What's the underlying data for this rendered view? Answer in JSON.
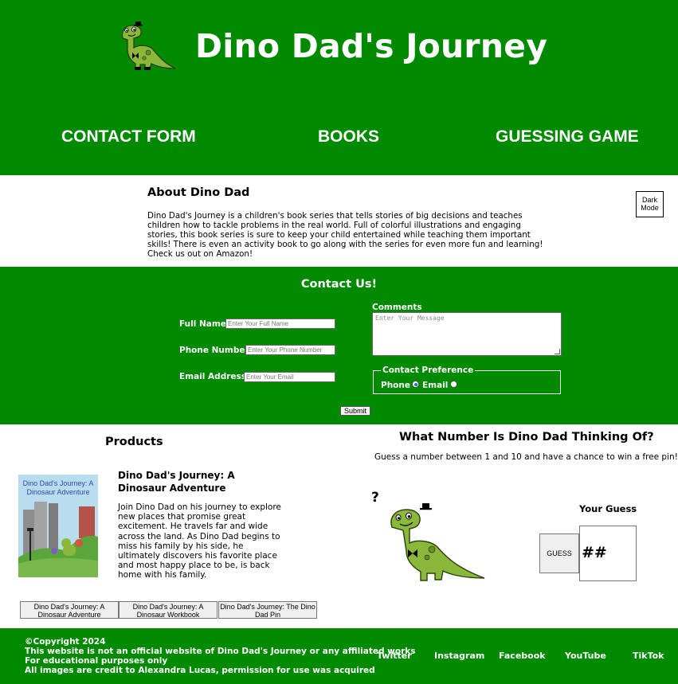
{
  "header": {
    "title": "Dino Dad's Journey",
    "nav": [
      "CONTACT FORM",
      "BOOKS",
      "GUESSING GAME"
    ]
  },
  "about": {
    "title": "About Dino Dad",
    "text": "Dino Dad's Journey is a children's book series that tells stories of big decisions and teaches children how to tackle problems in the real world. Full of colorful illustrations and engaging stories, this book series is sure to keep your child entertained while teaching them important skills! There is even an activity book to go along with the series for even more fun and learning! Check us out on Amazon!",
    "dark_mode_label": "Dark Mode"
  },
  "contact": {
    "title": "Contact Us!",
    "full_name_label": "Full Name:",
    "full_name_placeholder": "Enter Your Full Name",
    "phone_label": "Phone Number:",
    "phone_placeholder": "Enter Your Phone Number",
    "email_label": "Email Address:",
    "email_placeholder": "Enter Your Email",
    "comments_label": "Comments",
    "comments_placeholder": "Enter Your Message",
    "preference_legend": "Contact Preference",
    "option_phone": "Phone",
    "option_email": "Email",
    "selected_preference": "Phone",
    "submit_label": "Submit"
  },
  "products": {
    "title": "Products",
    "book": {
      "title": "Dino Dad's Journey: A Dinosaur Adventure",
      "cover_title": "Dino Dad's Journey: A Dinosaur Adventure",
      "description": "Join Dino Dad on his journey to explore new places that promise great excitement. He travels far and wide across the land. As Dino Dad begins to miss his family by his side, he ultimately discovers his favorite place and most happy place to be, is back home with his family."
    },
    "buttons": [
      "Dino Dad's Journey: A Dinosaur Adventure",
      "Dino Dad's Journey: A Dinosaur Workbook",
      "Dino Dad's Journey: The Dino Dad Pin"
    ]
  },
  "game": {
    "title": "What Number Is Dino Dad Thinking Of?",
    "subtitle": "Guess a number between 1 and 10 and have a chance to win a free pin!",
    "question_mark": "?",
    "guess_label": "Your Guess",
    "guess_button": "GUESS",
    "guess_value": "##"
  },
  "footer": {
    "copyright": "©Copyright 2024",
    "disclaimer": "This website is not an official website of Dino Dad's Journey or any affiliated works",
    "edu_note": "For educational purposes only",
    "credit": "All images are credit to Alexandra Lucas, permission for use was acquired",
    "social": [
      "Twitter",
      "Instagram",
      "Facebook",
      "YouTube",
      "TikTok"
    ]
  },
  "colors": {
    "brand_green": "#008a00",
    "dino_green": "#8ab83a",
    "link_blue": "#1a6fd6"
  }
}
